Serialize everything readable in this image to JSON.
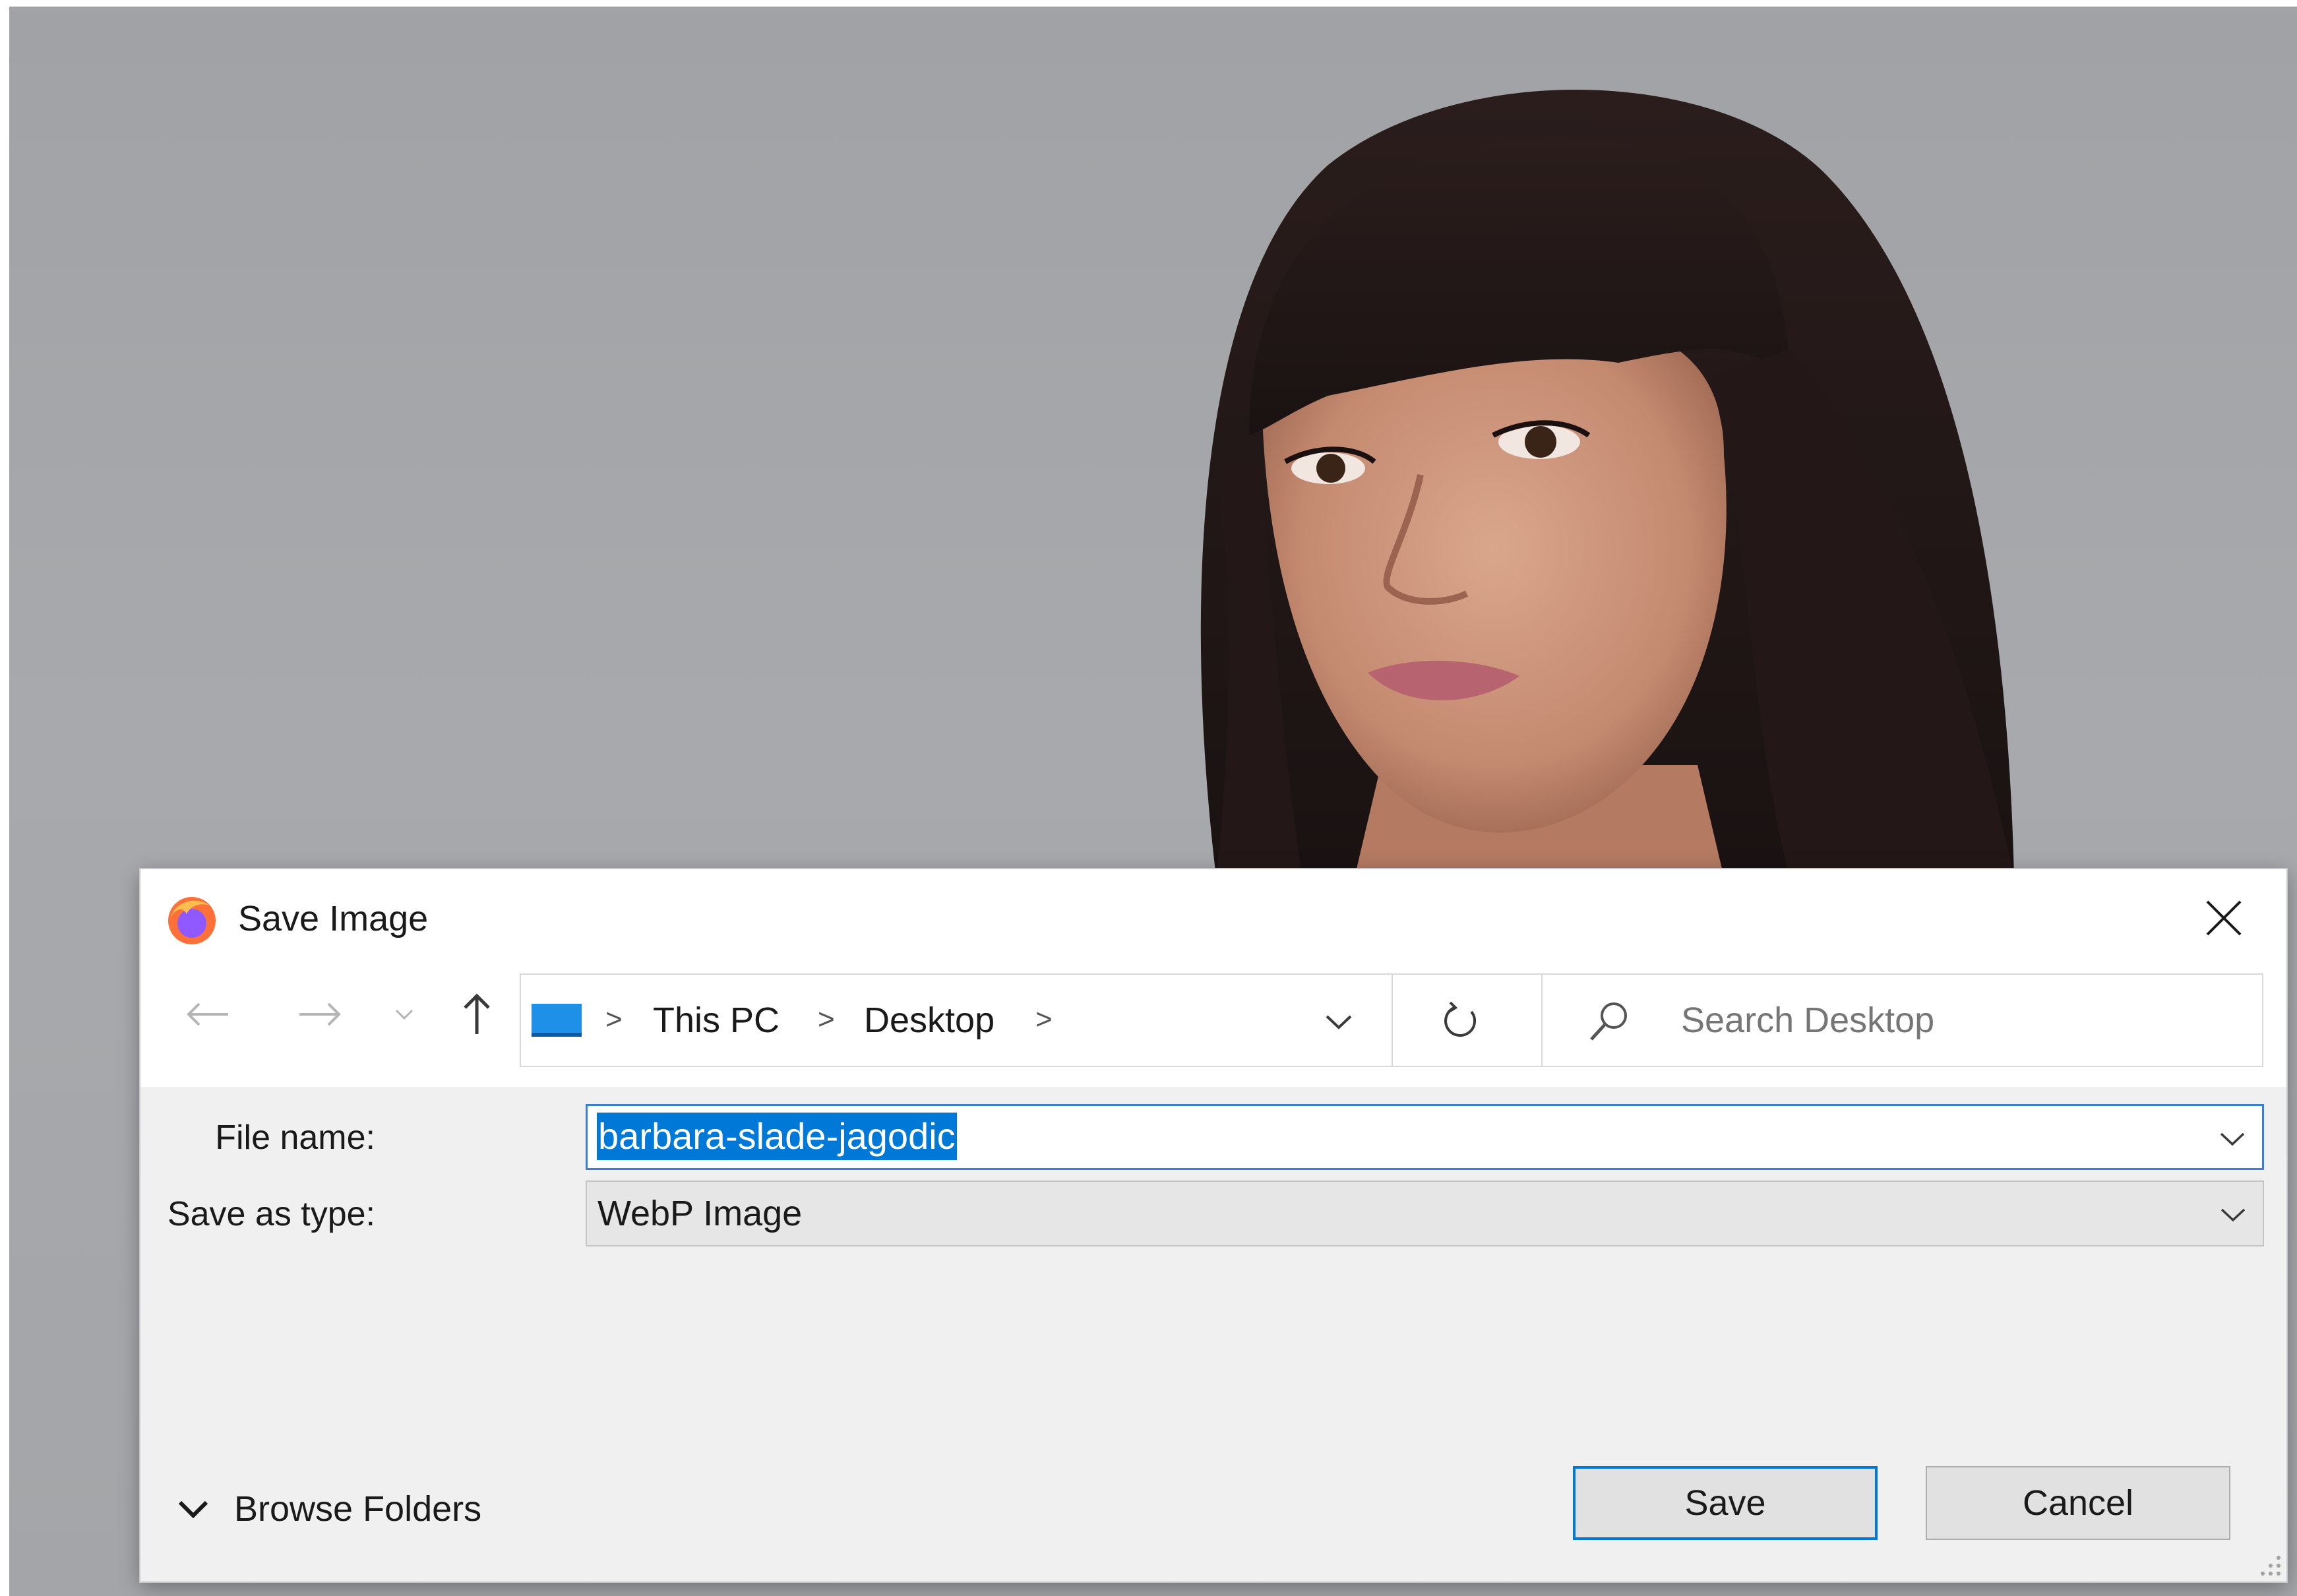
{
  "dialog": {
    "title": "Save Image",
    "app_icon": "firefox-icon",
    "close_icon": "close-icon"
  },
  "nav": {
    "back_icon": "arrow-left-icon",
    "forward_icon": "arrow-right-icon",
    "recent_icon": "chevron-down-icon",
    "up_icon": "arrow-up-icon"
  },
  "address": {
    "breadcrumbs": [
      "This PC",
      "Desktop"
    ],
    "location_icon": "desktop-pc-icon",
    "separator": ">",
    "refresh_icon": "refresh-icon"
  },
  "search": {
    "placeholder": "Search Desktop",
    "icon": "search-icon"
  },
  "form": {
    "file_name_label": "File name:",
    "file_name_value": "barbara-slade-jagodic",
    "save_as_type_label": "Save as type:",
    "save_as_type_value": "WebP Image"
  },
  "footer": {
    "browse_folders_label": "Browse Folders",
    "save_label": "Save",
    "cancel_label": "Cancel"
  },
  "colors": {
    "accent": "#0078d7",
    "background_photo": "#a5a7aa"
  }
}
